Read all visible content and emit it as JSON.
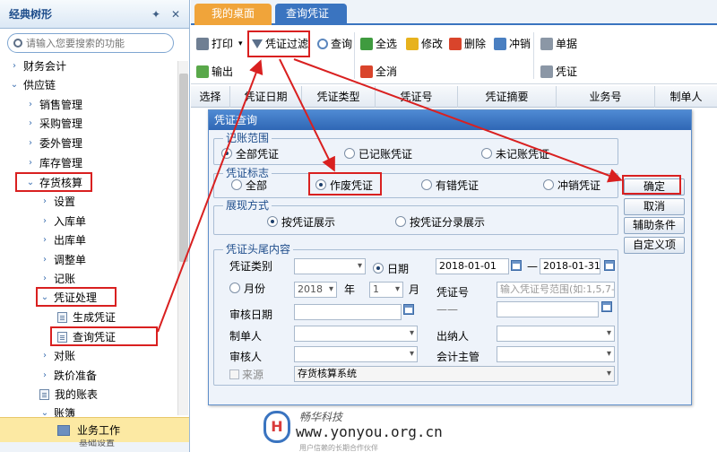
{
  "sidebar": {
    "title": "经典树形",
    "search_placeholder": "请输入您要搜索的功能",
    "items": [
      {
        "label": "财务会计"
      },
      {
        "label": "供应链"
      },
      {
        "label": "销售管理"
      },
      {
        "label": "采购管理"
      },
      {
        "label": "委外管理"
      },
      {
        "label": "库存管理"
      },
      {
        "label": "存货核算"
      },
      {
        "label": "设置"
      },
      {
        "label": "入库单"
      },
      {
        "label": "出库单"
      },
      {
        "label": "调整单"
      },
      {
        "label": "记账"
      },
      {
        "label": "凭证处理"
      },
      {
        "label": "生成凭证"
      },
      {
        "label": "查询凭证"
      },
      {
        "label": "对账"
      },
      {
        "label": "跌价准备"
      },
      {
        "label": "我的账表"
      },
      {
        "label": "账簿"
      }
    ],
    "bottom_label": "业务工作",
    "bottom2_label": "基础设置"
  },
  "tabs": {
    "desktop": "我的桌面",
    "query": "查询凭证",
    "close": "×"
  },
  "toolbar": {
    "print": "打印",
    "filter": "凭证过滤",
    "query": "查询",
    "select_all": "全选",
    "deselect_all": "全消",
    "modify": "修改",
    "delete": "删除",
    "reverse": "冲销",
    "doc": "单据",
    "voucher": "凭证",
    "export": "输出"
  },
  "grid": {
    "columns": [
      "选择",
      "凭证日期",
      "凭证类型",
      "凭证号",
      "凭证摘要",
      "业务号",
      "制单人"
    ]
  },
  "dialog": {
    "title": "凭证查询",
    "range_legend": "记账范围",
    "range_options": [
      "全部凭证",
      "已记账凭证",
      "未记账凭证"
    ],
    "flag_legend": "凭证标志",
    "flag_options": [
      "全部",
      "作废凭证",
      "有错凭证",
      "冲销凭证"
    ],
    "display_legend": "展现方式",
    "display_options": [
      "按凭证展示",
      "按凭证分录展示"
    ],
    "header_legend": "凭证头尾内容",
    "voucher_category": "凭证类别",
    "date_label": "日期",
    "date_from": "2018-01-01",
    "date_sep": "—",
    "date_to": "2018-01-31",
    "month_label": "月份",
    "year_value": "2018",
    "year_label": "年",
    "month_value": "1",
    "month_unit": "月",
    "voucher_no_label": "凭证号",
    "voucher_no_placeholder": "输入凭证号范围(如:1,5,7-9)",
    "voucher_no_sep": "——",
    "audit_date_label": "审核日期",
    "maker_label": "制单人",
    "cashier_label": "出纳人",
    "auditor_label": "审核人",
    "accountant_label": "会计主管",
    "source_label": "来源",
    "source_value": "存货核算系统",
    "btn_ok": "确定",
    "btn_cancel": "取消",
    "btn_aux": "辅助条件",
    "btn_custom": "自定义项"
  },
  "watermark": {
    "sub": "畅华科技",
    "url": "www.yonyou.org.cn",
    "small": "用户信赖的长期合作伙伴"
  }
}
